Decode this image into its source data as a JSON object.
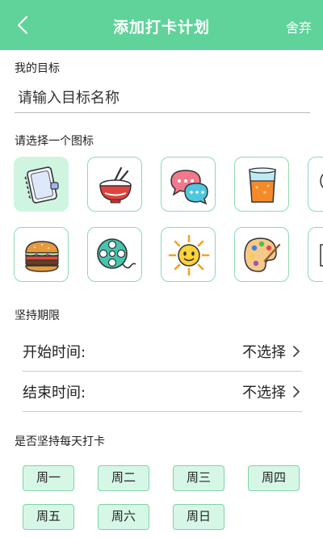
{
  "header": {
    "title": "添加打卡计划",
    "discard_label": "舍弃"
  },
  "goal": {
    "section_label": "我的目标",
    "placeholder": "请输入目标名称"
  },
  "icons": {
    "section_label": "请选择一个图标",
    "items": [
      {
        "name": "notebook-icon",
        "selected": true
      },
      {
        "name": "rice-bowl-icon",
        "selected": false
      },
      {
        "name": "chat-bubbles-icon",
        "selected": false
      },
      {
        "name": "juice-glass-icon",
        "selected": false
      },
      {
        "name": "lightbulb-icon",
        "selected": false
      },
      {
        "name": "hamburger-icon",
        "selected": false
      },
      {
        "name": "film-reel-icon",
        "selected": false
      },
      {
        "name": "sun-icon",
        "selected": false
      },
      {
        "name": "paint-palette-icon",
        "selected": false
      },
      {
        "name": "book-icon",
        "selected": false
      }
    ]
  },
  "duration": {
    "section_label": "坚持期限",
    "start_label": "开始时间:",
    "start_value": "不选择",
    "end_label": "结束时间:",
    "end_value": "不选择"
  },
  "daily": {
    "section_label": "是否坚持每天打卡",
    "days": [
      "周一",
      "周二",
      "周三",
      "周四",
      "周五",
      "周六",
      "周日"
    ]
  },
  "colors": {
    "accent": "#5fd39a",
    "chip_bg": "#d7f7e6",
    "chip_border": "#7fd3a5",
    "tile_border": "#8fd9b2",
    "selected_tile": "#cff5e0"
  }
}
